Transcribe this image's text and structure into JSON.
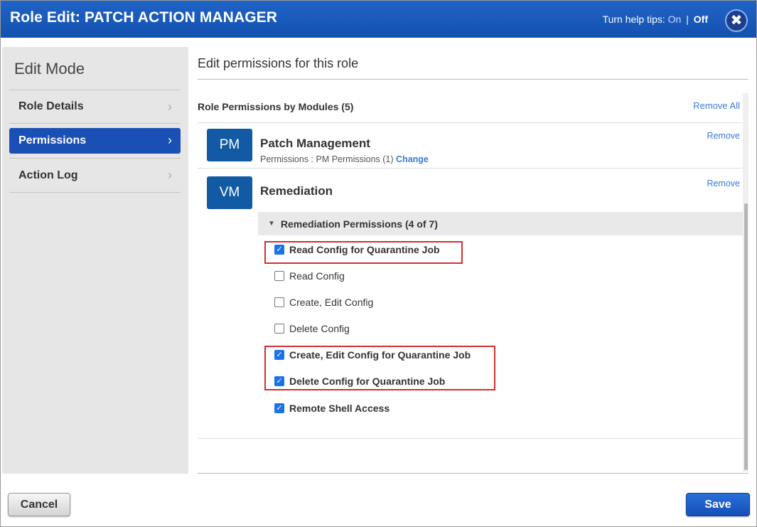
{
  "window": {
    "title": "Role Edit: PATCH ACTION MANAGER",
    "help_tips_label": "Turn help tips:",
    "help_on": "On",
    "help_separator": "|",
    "help_off": "Off",
    "close_icon": "close-icon"
  },
  "sidebar": {
    "title": "Edit Mode",
    "items": [
      {
        "label": "Role Details",
        "active": false
      },
      {
        "label": "Permissions",
        "active": true
      },
      {
        "label": "Action Log",
        "active": false
      }
    ]
  },
  "main": {
    "heading": "Edit permissions for this role",
    "section_label": "Role Permissions by Modules (5)",
    "remove_all": "Remove All",
    "modules": [
      {
        "badge": "PM",
        "name": "Patch Management",
        "subtitle": "Permissions : PM Permissions (1)",
        "change_link": "Change",
        "remove": "Remove"
      },
      {
        "badge": "VM",
        "name": "Remediation",
        "remove": "Remove",
        "group_label": "Remediation Permissions (4 of 7)",
        "permissions": [
          {
            "label": "Read Config for Quarantine Job",
            "checked": true
          },
          {
            "label": "Read Config",
            "checked": false
          },
          {
            "label": "Create, Edit Config",
            "checked": false
          },
          {
            "label": "Delete Config",
            "checked": false
          },
          {
            "label": "Create, Edit Config for Quarantine Job",
            "checked": true
          },
          {
            "label": "Delete Config for Quarantine Job",
            "checked": true
          },
          {
            "label": "Remote Shell Access",
            "checked": true
          }
        ]
      }
    ]
  },
  "footer": {
    "cancel": "Cancel",
    "save": "Save"
  },
  "colors": {
    "titlebar": "#1451b0",
    "accent": "#1a4fb5",
    "module_badge": "#125aa3",
    "link": "#3a7bd5",
    "highlight_box": "#d32f2f"
  }
}
